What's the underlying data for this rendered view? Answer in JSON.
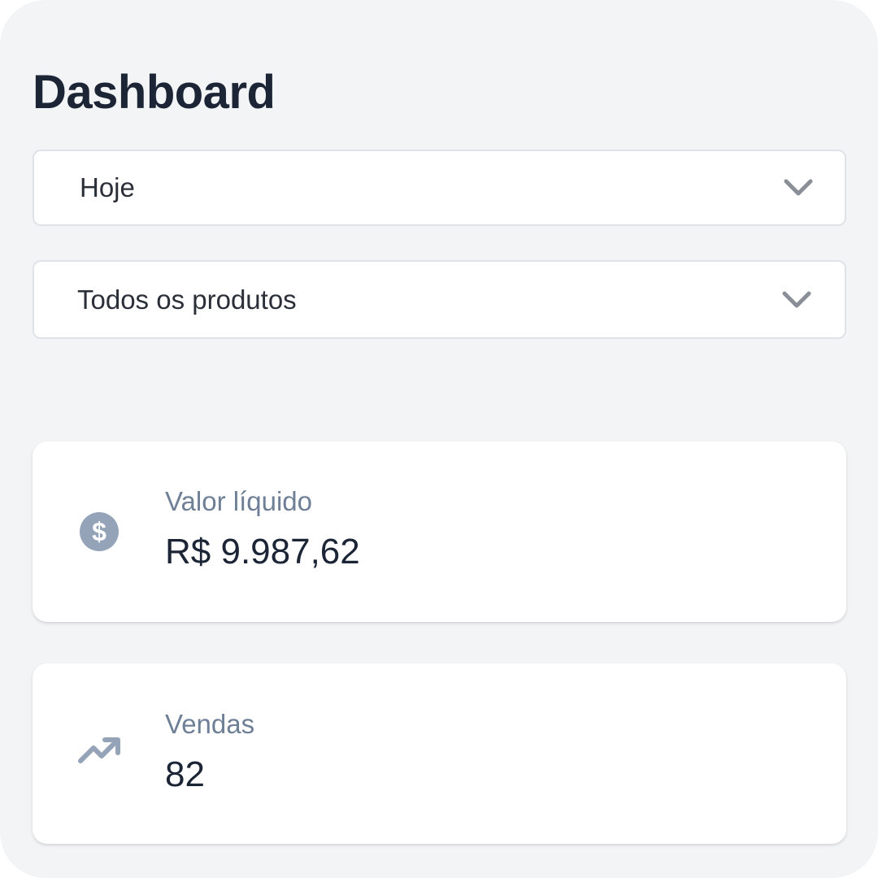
{
  "page": {
    "title": "Dashboard"
  },
  "filters": {
    "period": {
      "value": "Hoje",
      "icon": "chevron-down-icon"
    },
    "product": {
      "value": "Todos os produtos",
      "icon": "chevron-down-icon"
    }
  },
  "metrics": [
    {
      "label": "Valor líquido",
      "value": "R$ 9.987,62",
      "icon": "dollar-circle-icon"
    },
    {
      "label": "Vendas",
      "value": "82",
      "icon": "trending-up-icon"
    }
  ],
  "colors": {
    "background": "#f3f4f6",
    "card": "#ffffff",
    "title": "#1b2536",
    "label": "#6e7f96",
    "icon": "#94a3b8",
    "chevron": "#8a8f97"
  }
}
